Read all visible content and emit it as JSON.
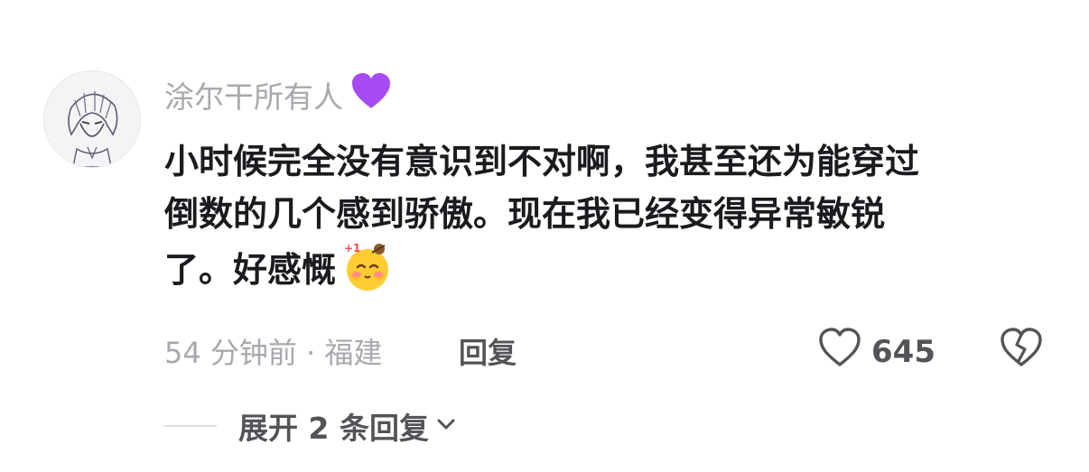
{
  "comment": {
    "username": "涂尔干所有人",
    "username_badge_icon": "purple-heart-icon",
    "text_lines": [
      "小时候完全没有意识到不对啊，我甚至还为能穿过",
      "倒数的几个感到骄傲。现在我已经变得异常敏锐",
      "了。好感慨"
    ],
    "inline_emoji_icon": "plus-one-blush-emoji",
    "meta": "54 分钟前 · 福建",
    "reply_label": "回复",
    "like_count": "645",
    "expand_label": "展开 2 条回复"
  },
  "colors": {
    "heart_badge": "#a64bf4",
    "emoji_face": "#ffcc33",
    "text_primary": "#1b1b1f",
    "text_secondary": "#a8a8ae",
    "text_action": "#545458"
  }
}
